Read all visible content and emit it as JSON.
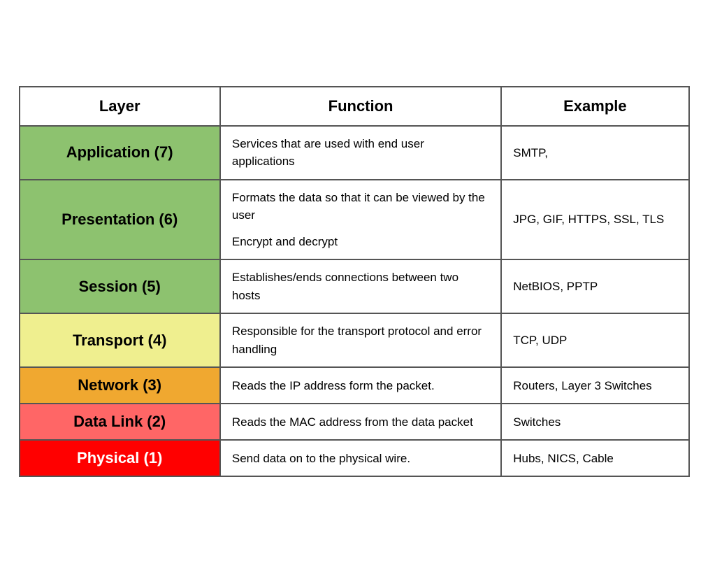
{
  "header": {
    "col1": "Layer",
    "col2": "Function",
    "col3": "Example"
  },
  "rows": [
    {
      "id": "app",
      "layer": "Application (7)",
      "function": "Services that are used with end user applications",
      "example": "SMTP,",
      "layerColor": "#8DC26F",
      "textColor": "#000"
    },
    {
      "id": "pres",
      "layer": "Presentation (6)",
      "function": "Formats the data so that it can be viewed by the user\n\nEncrypt and decrypt",
      "example": "JPG, GIF, HTTPS, SSL, TLS",
      "layerColor": "#8DC26F",
      "textColor": "#000"
    },
    {
      "id": "sess",
      "layer": "Session (5)",
      "function": "Establishes/ends connections between two hosts",
      "example": "NetBIOS, PPTP",
      "layerColor": "#8DC26F",
      "textColor": "#000"
    },
    {
      "id": "trans",
      "layer": "Transport (4)",
      "function": "Responsible for the transport protocol and error handling",
      "example": "TCP, UDP",
      "layerColor": "#EFEF8F",
      "textColor": "#000"
    },
    {
      "id": "net",
      "layer": "Network (3)",
      "function": "Reads the IP address form the packet.",
      "example": "Routers, Layer 3 Switches",
      "layerColor": "#F0A830",
      "textColor": "#000"
    },
    {
      "id": "data",
      "layer": "Data Link (2)",
      "function": "Reads the MAC address from the data packet",
      "example": "Switches",
      "layerColor": "#FF6666",
      "textColor": "#000"
    },
    {
      "id": "phys",
      "layer": "Physical (1)",
      "function": "Send data on to the physical wire.",
      "example": "Hubs, NICS, Cable",
      "layerColor": "#FF0000",
      "textColor": "#ffffff"
    }
  ]
}
